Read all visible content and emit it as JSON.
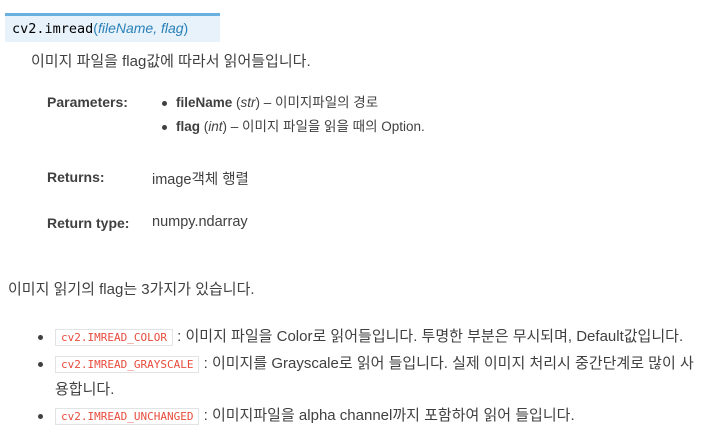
{
  "signature": {
    "name": "cv2.imread",
    "open_paren": "(",
    "params": "fileName, flag",
    "close_paren": ")"
  },
  "description": "이미지 파일을 flag값에 따라서 읽어들입니다.",
  "fields": {
    "parameters_label": "Parameters:",
    "params": [
      {
        "name": "fileName",
        "type": "str",
        "desc": " – 이미지파일의 경로"
      },
      {
        "name": "flag",
        "type": "int",
        "desc": " – 이미지 파일을 읽을 때의 Option."
      }
    ],
    "returns_label": "Returns:",
    "returns_value": "image객체 행렬",
    "return_type_label": "Return type:",
    "return_type_value": "numpy.ndarray"
  },
  "intro": "이미지 읽기의 flag는 3가지가 있습니다.",
  "flags": [
    {
      "code": "cv2.IMREAD_COLOR",
      "text": " : 이미지 파일을 Color로 읽어들입니다. 투명한 부분은 무시되며, Default값입니다."
    },
    {
      "code": "cv2.IMREAD_GRAYSCALE",
      "text": " : 이미지를 Grayscale로 읽어 들입니다. 실제 이미지 처리시 중간단계로 많이 사용합니다."
    },
    {
      "code": "cv2.IMREAD_UNCHANGED",
      "text": " : 이미지파일을 alpha channel까지 포함하여 읽어 들입니다."
    }
  ],
  "colors": {
    "signature_bg": "#e7f2fa",
    "signature_border": "#6ab0de",
    "param_link": "#2980b9",
    "code_text": "#e74c3c",
    "body_text": "#404040"
  }
}
